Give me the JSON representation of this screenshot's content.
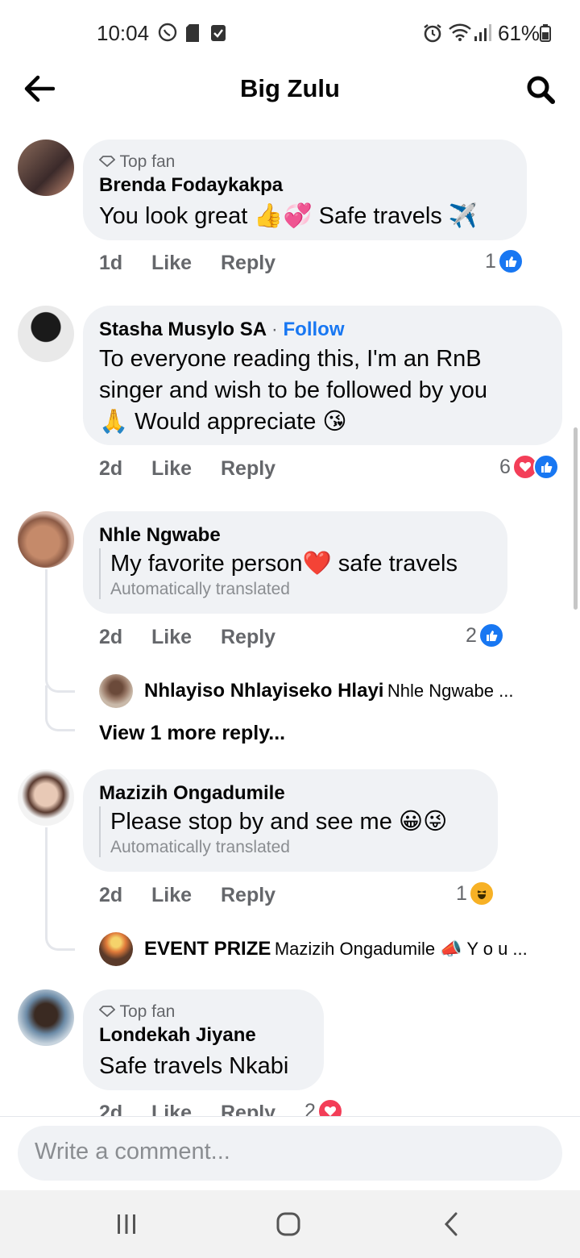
{
  "status_bar": {
    "time": "10:04",
    "battery": "61%"
  },
  "header": {
    "title": "Big Zulu"
  },
  "comments": [
    {
      "badge": "Top fan",
      "author": "Brenda Fodaykakpa",
      "text": "You look great 👍💞 Safe travels ✈️",
      "time": "1d",
      "like": "Like",
      "reply": "Reply",
      "reaction_count": "1"
    },
    {
      "author": "Stasha Musylo SA",
      "follow": "Follow",
      "text_line1": "To everyone reading this, I'm an RnB",
      "text_line2": "singer and wish to be followed by you",
      "text_line3": "🙏 Would appreciate 😘",
      "time": "2d",
      "like": "Like",
      "reply": "Reply",
      "reaction_count": "6"
    },
    {
      "author": "Nhle Ngwabe",
      "text": "My favorite person❤️ safe travels",
      "translated_note": "Automatically translated",
      "time": "2d",
      "like": "Like",
      "reply": "Reply",
      "reaction_count": "2",
      "reply_preview": {
        "author": "Nhlayiso Nhlayiseko Hlayi",
        "snippet": "Nhle Ngwabe ..."
      },
      "view_more": "View 1 more reply..."
    },
    {
      "author": "Mazizih Ongadumile",
      "text": "Please stop by and see me 😀😜",
      "translated_note": "Automatically translated",
      "time": "2d",
      "like": "Like",
      "reply": "Reply",
      "reaction_count": "1",
      "reply_preview": {
        "author": "EVENT PRIZE",
        "snippet": "Mazizih Ongadumile 📣 Y o u ..."
      }
    },
    {
      "badge": "Top fan",
      "author": "Londekah Jiyane",
      "text": "Safe travels Nkabi",
      "time": "2d",
      "like": "Like",
      "reply": "Reply",
      "reaction_count": "2"
    }
  ],
  "composer": {
    "placeholder": "Write a comment..."
  },
  "colors": {
    "accent": "#1877f2",
    "bubble": "#f0f2f5",
    "love": "#f33e58"
  }
}
